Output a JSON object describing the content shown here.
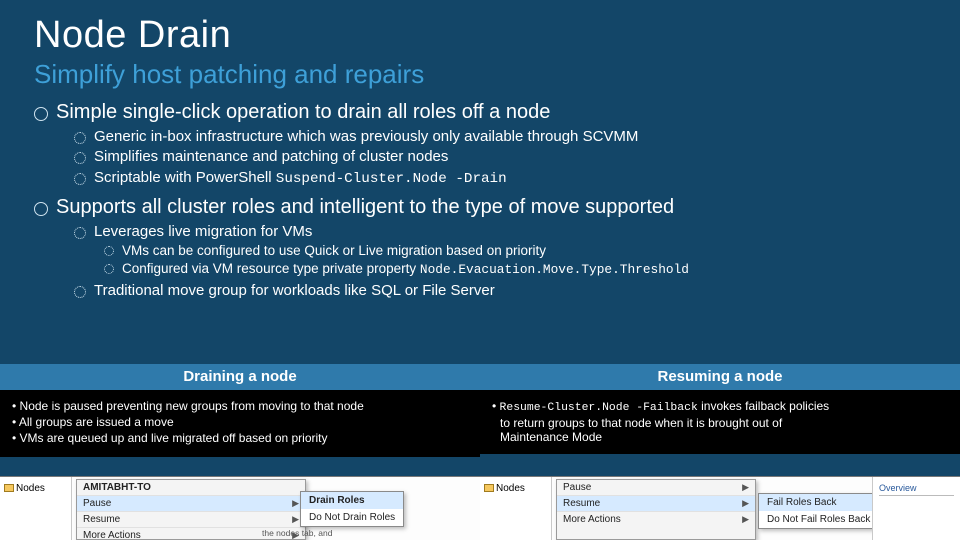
{
  "title": "Node Drain",
  "subtitle": "Simplify host patching and repairs",
  "bullets": {
    "p1": "Simple single-click operation to drain all roles off a node",
    "p1a": "Generic in-box infrastructure which was previously only available through SCVMM",
    "p1b": "Simplifies maintenance and patching of cluster nodes",
    "p1c_pre": "Scriptable with PowerShell ",
    "p1c_code": "Suspend-Cluster.Node -Drain",
    "p2": "Supports all cluster roles and intelligent to the type of move supported",
    "p2a": "Leverages live migration for VMs",
    "p2a_i": "VMs can be configured to use Quick or Live migration based on priority",
    "p2a_ii_pre": "Configured via VM resource type private property ",
    "p2a_ii_code": "Node.Evacuation.Move.Type.Threshold",
    "p2b": "Traditional move group for workloads like SQL or File Server"
  },
  "panels": {
    "left": {
      "header": "Draining a node",
      "lines": [
        "Node is paused preventing new groups from moving to that node",
        "All groups are issued a move",
        "VMs are queued up and live migrated off based on priority"
      ]
    },
    "right": {
      "header": "Resuming a node",
      "line_code": "Resume-Cluster.Node -Failback",
      "line_rest1": " invokes failback policies",
      "line2": "to return groups to that node when it is brought out of",
      "line3": "Maintenance Mode"
    }
  },
  "shots": {
    "left": {
      "tree_label": "Nodes",
      "header": "AMITABHT-TO",
      "menu": [
        "Pause",
        "Resume",
        "More Actions"
      ],
      "flyout": [
        "Drain Roles",
        "Do Not Drain Roles"
      ],
      "hint": "the nodes tab, and"
    },
    "right": {
      "tree_label": "Nodes",
      "menu": [
        "Pause",
        "Resume",
        "More Actions"
      ],
      "flyout": [
        "Fail Roles Back",
        "Do Not Fail Roles Back"
      ],
      "side": "Overview"
    }
  }
}
